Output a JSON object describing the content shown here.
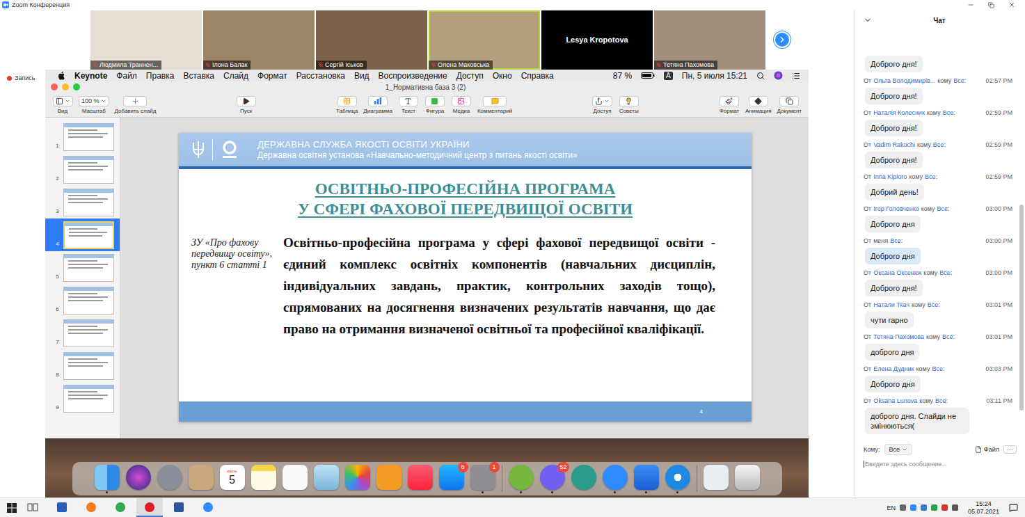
{
  "window": {
    "title": "Zoom Конференция"
  },
  "recording": {
    "label": "Запись"
  },
  "video_strip": {
    "participants": [
      {
        "name": "Людмила Траннен...",
        "muted": true,
        "video": true,
        "active": false
      },
      {
        "name": "Ілона Балак",
        "muted": true,
        "video": true,
        "active": false
      },
      {
        "name": "Сергій Іськов",
        "muted": true,
        "video": true,
        "active": false
      },
      {
        "name": "Олена Маковська",
        "muted": true,
        "video": true,
        "active": true
      },
      {
        "name": "Lesya  Kropotova",
        "muted": false,
        "video": false,
        "active": false
      },
      {
        "name": "Тетяна Пахомова",
        "muted": true,
        "video": true,
        "active": false
      }
    ]
  },
  "mac_menubar": {
    "app": "Keynote",
    "menus": [
      "Файл",
      "Правка",
      "Вставка",
      "Слайд",
      "Формат",
      "Расстановка",
      "Вид",
      "Воспроизведение",
      "Доступ",
      "Окно",
      "Справка"
    ],
    "battery": "87 %",
    "input_source": "A",
    "clock": "Пн, 5 июля 15:21"
  },
  "keynote": {
    "title": "1_Нормативна база 3 (2)",
    "toolbar": [
      {
        "label": "Вид",
        "kind": "view"
      },
      {
        "label": "Масштаб",
        "kind": "zoom",
        "value": "100 %"
      },
      {
        "label": "Добавить слайд",
        "kind": "add"
      },
      {
        "label": "Пуск",
        "kind": "play"
      },
      {
        "label": "Таблица",
        "kind": "table"
      },
      {
        "label": "Диаграмма",
        "kind": "chart"
      },
      {
        "label": "Текст",
        "kind": "text"
      },
      {
        "label": "Фигура",
        "kind": "shape"
      },
      {
        "label": "Медиа",
        "kind": "media"
      },
      {
        "label": "Комментарий",
        "kind": "comment"
      },
      {
        "label": "Доступ",
        "kind": "share"
      },
      {
        "label": "Советы",
        "kind": "tips"
      },
      {
        "label": "Формат",
        "kind": "format"
      },
      {
        "label": "Анимация",
        "kind": "animate"
      },
      {
        "label": "Документ",
        "kind": "document"
      }
    ],
    "slides": [
      {
        "number": "1",
        "selected": false
      },
      {
        "number": "2",
        "selected": false
      },
      {
        "number": "3",
        "selected": false
      },
      {
        "number": "4",
        "selected": true
      },
      {
        "number": "5",
        "selected": false
      },
      {
        "number": "6",
        "selected": false
      },
      {
        "number": "7",
        "selected": false
      },
      {
        "number": "8",
        "selected": false
      },
      {
        "number": "9",
        "selected": false
      }
    ]
  },
  "slide": {
    "header_title": "ДЕРЖАВНА СЛУЖБА ЯКОСТІ ОСВІТИ УКРАЇНИ",
    "header_subtitle": "Державна освітня установа «Навчально-методичний центр з питань якості освіти»",
    "title_lines": [
      "ОСВІТНЬО-ПРОФЕСІЙНА ПРОГРАМА",
      "У СФЕРІ ФАХОВОЇ ПЕРЕДВИЩОЇ ОСВІТИ"
    ],
    "reference": "ЗУ «Про фахову передвищу освіту», пункт 6 статті 1",
    "body": "Освітньо-професійна програма у сфері фахової передвищої освіти - єдиний комплекс освітніх компонентів (навчальних дисциплін, індивідуальних завдань, практик, контрольних заходів тощо), спрямованих на досягнення визначених результатів навчання, що дає право на отримання визначеної освітньої та професійної кваліфікації.",
    "page": "4"
  },
  "dock": [
    {
      "kind": "finder",
      "running": true
    },
    {
      "kind": "siri",
      "running": false
    },
    {
      "kind": "launchpad",
      "running": false
    },
    {
      "kind": "contacts",
      "running": false
    },
    {
      "kind": "calendar",
      "running": false,
      "month": "июль",
      "day": "5"
    },
    {
      "kind": "notes",
      "running": false
    },
    {
      "kind": "reminders",
      "running": false
    },
    {
      "kind": "preview",
      "running": false
    },
    {
      "kind": "photos",
      "running": false
    },
    {
      "kind": "pages",
      "running": false
    },
    {
      "kind": "music",
      "running": false
    },
    {
      "kind": "appstore",
      "running": false,
      "badge": "6"
    },
    {
      "kind": "sysprefs",
      "running": true,
      "badge": "1"
    },
    {
      "kind": "separator",
      "running": false
    },
    {
      "kind": "utorrent",
      "running": true
    },
    {
      "kind": "viber",
      "running": true,
      "badge": "52"
    },
    {
      "kind": "facetime",
      "running": false
    },
    {
      "kind": "zoom",
      "running": true
    },
    {
      "kind": "keynote",
      "running": true
    },
    {
      "kind": "safari",
      "running": true
    },
    {
      "kind": "separator",
      "running": false
    },
    {
      "kind": "mail",
      "running": false
    },
    {
      "kind": "trash",
      "running": false
    }
  ],
  "chat": {
    "title": "Чат",
    "prefix": "От",
    "messages": [
      {
        "text": "Доброго дня!",
        "partial": true,
        "self": false
      },
      {
        "from": "Ольга Володимирів...",
        "to_label": "кому",
        "to": "Все:",
        "time": "02:57 PM",
        "text": "Доброго дня!",
        "self": false
      },
      {
        "from": "Наталія Колесник",
        "to_label": "кому",
        "to": "Все:",
        "time": "02:59 PM",
        "text": "Доброго дня!",
        "self": false
      },
      {
        "from": "Vadim Rakochi",
        "to_label": "кому",
        "to": "Все:",
        "time": "02:59 PM",
        "text": "Доброго дня!",
        "self": false
      },
      {
        "from": "Inna Kipioro",
        "to_label": "кому",
        "to": "Все:",
        "time": "02:59 PM",
        "text": "Добрий день!",
        "self": false
      },
      {
        "from": "Ігор Головченко",
        "to_label": "кому",
        "to": "Все:",
        "time": "03:00 PM",
        "text": "Доброго дня",
        "self": false
      },
      {
        "from": "меня",
        "to": "Все:",
        "time": "03:00 PM",
        "text": "Доброго дня",
        "self": true
      },
      {
        "from": "Оксана Оксенюк",
        "to_label": "кому",
        "to": "Все:",
        "time": "03:00 PM",
        "text": "Доброго дня!",
        "self": false
      },
      {
        "from": "Натали Ткач",
        "to_label": "кому",
        "to": "Все:",
        "time": "03:01 PM",
        "text": "чути гарно",
        "self": false
      },
      {
        "from": "Тетяна Пахомова",
        "to_label": "кому",
        "to": "Все:",
        "time": "03:01 PM",
        "text": "доброго дня",
        "self": false
      },
      {
        "from": "Елена Дудник",
        "to_label": "кому",
        "to": "Все:",
        "time": "03:03 PM",
        "text": "Доброго дня",
        "self": false
      },
      {
        "from": "Oksana Lunova",
        "to_label": "кому",
        "to": "Все:",
        "time": "03:11 PM",
        "text": "доброго дня. Слайди не змінюються(",
        "self": false
      }
    ],
    "to_label": "Кому:",
    "to_value": "Все",
    "file": "Файл",
    "more": "···",
    "placeholder": "Введите здесь сообщение..."
  },
  "taskbar": {
    "apps": [
      {
        "kind": "taskview",
        "selected": false
      },
      {
        "kind": "save",
        "selected": false
      },
      {
        "kind": "firefox",
        "selected": false
      },
      {
        "kind": "chrome",
        "selected": false
      },
      {
        "kind": "opera",
        "selected": true
      },
      {
        "kind": "editor",
        "selected": false
      },
      {
        "kind": "zoom",
        "selected": false
      }
    ],
    "lang": "EN",
    "time": "15:24",
    "date": "05.07.2021"
  }
}
